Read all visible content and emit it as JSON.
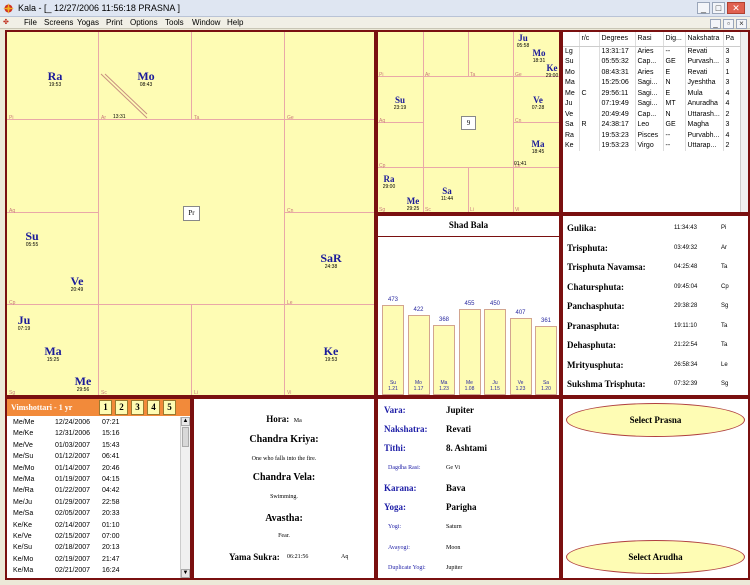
{
  "window": {
    "title": "Kala - [_  12/27/2006  11:56:18        PRASNA ]"
  },
  "menu": [
    "File",
    "Screens",
    "Yogas",
    "Print",
    "Options",
    "Tools",
    "Window",
    "Help"
  ],
  "south_chart": {
    "signs": [
      "Pi",
      "Ar",
      "Ta",
      "Ge",
      "Cn",
      "Le",
      "Vi",
      "Li",
      "Sc",
      "Sg",
      "Cp",
      "Aq"
    ],
    "mid_time": "13:31",
    "center": "Pr",
    "planets": [
      {
        "n": "Ra",
        "t": "19:53"
      },
      {
        "n": "Mo",
        "t": "08:43"
      },
      {
        "n": "Su",
        "t": "05:55"
      },
      {
        "n": "Ve",
        "t": "20:49"
      },
      {
        "n": "Ju",
        "t": "07:19"
      },
      {
        "n": "Ma",
        "t": "15:25"
      },
      {
        "n": "Me",
        "t": "29:56"
      },
      {
        "n": "SaR",
        "t": "24:38"
      },
      {
        "n": "Ke",
        "t": "19:53"
      }
    ]
  },
  "navamsa_chart": {
    "signs": [
      "Pi",
      "Ar",
      "Ta",
      "Ge",
      "Aq",
      "Cn",
      "Cp",
      "Le",
      "Sg",
      "Sc",
      "Li",
      "Vi"
    ],
    "center": "9",
    "mid_time": "01:41",
    "planets": [
      {
        "n": "Ju",
        "t": "05:58"
      },
      {
        "n": "Mo",
        "t": "18:31"
      },
      {
        "n": "Ke",
        "t": "29:00"
      },
      {
        "n": "Su",
        "t": "23:19"
      },
      {
        "n": "Ve",
        "t": "07:28"
      },
      {
        "n": "Ma",
        "t": "18:45"
      },
      {
        "n": "Ra",
        "t": "29:00"
      },
      {
        "n": "Me",
        "t": "29:25"
      },
      {
        "n": "Sa",
        "t": "11:44"
      }
    ]
  },
  "planet_table": {
    "headers": [
      "",
      "r/c",
      "Degrees",
      "Rasi",
      "Dig...",
      "Nakshatra",
      "Pa"
    ],
    "rows": [
      [
        "Lg",
        "",
        "13:31:17",
        "Aries",
        "--",
        "Revati",
        "3"
      ],
      [
        "Su",
        "",
        "05:55:32",
        "Cap...",
        "GE",
        "Purvash...",
        "3"
      ],
      [
        "Mo",
        "",
        "08:43:31",
        "Aries",
        "E",
        "Revati",
        "1"
      ],
      [
        "Ma",
        "",
        "15:25:06",
        "Sagi...",
        "N",
        "Jyeshtha",
        "3"
      ],
      [
        "Me",
        "C",
        "29:56:11",
        "Sagi...",
        "E",
        "Mula",
        "4"
      ],
      [
        "Ju",
        "",
        "07:19:49",
        "Sagi...",
        "MT",
        "Anuradha",
        "4"
      ],
      [
        "Ve",
        "",
        "20:49:49",
        "Cap...",
        "N",
        "Uttarash...",
        "2"
      ],
      [
        "Sa",
        "R",
        "24:38:17",
        "Leo",
        "GE",
        "Magha",
        "3"
      ],
      [
        "Ra",
        "",
        "19:53:23",
        "Pisces",
        "--",
        "Purvabh...",
        "4"
      ],
      [
        "Ke",
        "",
        "19:53:23",
        "Virgo",
        "--",
        "Uttarap...",
        "2"
      ]
    ]
  },
  "shad_bala": {
    "title": "Shad Bala",
    "bars": [
      {
        "p": "Su",
        "v": 473,
        "r": "1.21"
      },
      {
        "p": "Mo",
        "v": 422,
        "r": "1.17"
      },
      {
        "p": "Ma",
        "v": 368,
        "r": "1.23"
      },
      {
        "p": "Me",
        "v": 455,
        "r": "1.08"
      },
      {
        "p": "Ju",
        "v": 450,
        "r": "1.15"
      },
      {
        "p": "Ve",
        "v": 407,
        "r": "1.23"
      },
      {
        "p": "Sa",
        "v": 361,
        "r": "1.20"
      }
    ]
  },
  "upagrahas": [
    {
      "n": "Gulika:",
      "v": "11:34:43",
      "s": "Pi"
    },
    {
      "n": "Trisphuta:",
      "v": "03:49:32",
      "s": "Ar"
    },
    {
      "n": "Trisphuta Navamsa:",
      "v": "04:25:48",
      "s": "Ta"
    },
    {
      "n": "Chatursphuta:",
      "v": "09:45:04",
      "s": "Cp"
    },
    {
      "n": "Panchasphuta:",
      "v": "29:38:28",
      "s": "Sg"
    },
    {
      "n": "Pranasphuta:",
      "v": "19:11:10",
      "s": "Ta"
    },
    {
      "n": "Dehasphuta:",
      "v": "21:22:54",
      "s": "Ta"
    },
    {
      "n": "Mrityusphuta:",
      "v": "26:58:34",
      "s": "Le"
    },
    {
      "n": "Sukshma Trisphuta:",
      "v": "07:32:39",
      "s": "Sg"
    }
  ],
  "dasha": {
    "header": "Vimshottari - 1 yr",
    "tabs": [
      "1",
      "2",
      "3",
      "4",
      "5"
    ],
    "rows": [
      [
        "Me/Me",
        "12/24/2006",
        "07:21"
      ],
      [
        "Me/Ke",
        "12/31/2006",
        "15:16"
      ],
      [
        "Me/Ve",
        "01/03/2007",
        "15:43"
      ],
      [
        "Me/Su",
        "01/12/2007",
        "06:41"
      ],
      [
        "Me/Mo",
        "01/14/2007",
        "20:46"
      ],
      [
        "Me/Ma",
        "01/19/2007",
        "04:15"
      ],
      [
        "Me/Ra",
        "01/22/2007",
        "04:42"
      ],
      [
        "Me/Ju",
        "01/29/2007",
        "22:58"
      ],
      [
        "Me/Sa",
        "02/05/2007",
        "20:33"
      ],
      [
        "Ke/Ke",
        "02/14/2007",
        "01:10"
      ],
      [
        "Ke/Ve",
        "02/15/2007",
        "07:00"
      ],
      [
        "Ke/Su",
        "02/18/2007",
        "20:13"
      ],
      [
        "Ke/Mo",
        "02/19/2007",
        "21:47"
      ],
      [
        "Ke/Ma",
        "02/21/2007",
        "16:24"
      ]
    ]
  },
  "hora": {
    "hora_label": "Hora:",
    "hora_value": "Ma",
    "kriya_label": "Chandra Kriya:",
    "kriya_value": "One who falls into the fire.",
    "vela_label": "Chandra Vela:",
    "vela_value": "Swimming.",
    "avastha_label": "Avastha:",
    "avastha_value": "Fear.",
    "sukra_label": "Yama Sukra:",
    "sukra_time": "06:21:56",
    "sukra_sign": "Aq"
  },
  "panchanga": {
    "vara_label": "Vara:",
    "vara": "Jupiter",
    "nak_label": "Nakshatra:",
    "nak": "Revati",
    "tithi_label": "Tithi:",
    "tithi": "8. Ashtami",
    "dagdha_label": "Dagdha Rasi:",
    "dagdha": "Ge  Vi",
    "karana_label": "Karana:",
    "karana": "Bava",
    "yoga_label": "Yoga:",
    "yoga": "Parigha",
    "yogi_label": "Yogi:",
    "yogi": "Saturn",
    "avayogi_label": "Avayogi:",
    "avayogi": "Moon",
    "dup_label": "Duplicate Yogi:",
    "dup": "Jupiter"
  },
  "actions": {
    "prasna": "Select Prasna",
    "arudha": "Select Arudha"
  }
}
